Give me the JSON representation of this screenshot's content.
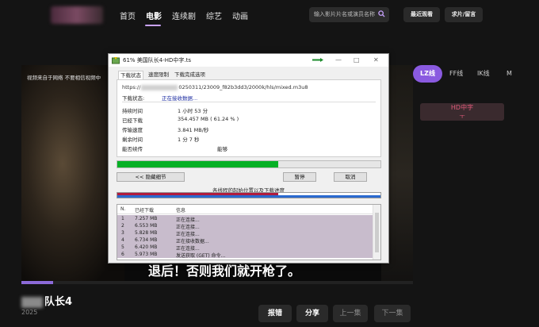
{
  "nav": {
    "items": [
      {
        "label": "首页",
        "active": false
      },
      {
        "label": "电影",
        "active": true
      },
      {
        "label": "连续剧",
        "active": false
      },
      {
        "label": "综艺",
        "active": false
      },
      {
        "label": "动画",
        "active": false
      }
    ],
    "search_placeholder": "输入影片片名或演员名称",
    "recent_label": "最近观看",
    "request_label": "求片/留言"
  },
  "player": {
    "warning": "视频来自于网络 不要相信视频中",
    "subtitle": "退后！否则我们就开枪了。",
    "progress": 0.08
  },
  "lines": {
    "tabs": [
      {
        "label": "LZ线",
        "active": true
      },
      {
        "label": "FF线",
        "active": false
      },
      {
        "label": "IK线",
        "active": false
      },
      {
        "label": "M",
        "active": false
      }
    ],
    "episode_card": {
      "line1": "HD中字",
      "line2": "ㅜ"
    }
  },
  "movie": {
    "title_suffix": "队长4",
    "year": "2025"
  },
  "actions": {
    "report": "报错",
    "share": "分享",
    "prev": "上一集",
    "next": "下一集"
  },
  "dialog": {
    "title": "61% 美国队长4-HD中字.ts",
    "tabs": [
      "下载状态",
      "速度限制",
      "下载完成选项"
    ],
    "url_prefix": "https://",
    "url_suffix": "0250311/23009_f82b3dd3/2000k/hls/mixed.m3u8",
    "status_label": "下载状态:",
    "status_value": "正在接收数据...",
    "rows": [
      {
        "label": "持续时间",
        "value": "1 小时 53 分"
      },
      {
        "label": "已经下载",
        "value": "354.457  MB  ( 61.24 % )"
      },
      {
        "label": "传输速度",
        "value": "3.841  MB/秒"
      },
      {
        "label": "剩余时间",
        "value": "1 分 7 秒"
      },
      {
        "label": "能否续传",
        "value": "能够"
      }
    ],
    "progress": 0.6124,
    "hide_details": "<< 隐藏细节",
    "pause": "暂停",
    "cancel": "取消",
    "connections_label": "各线程的起始位置以及下载进度",
    "table_headers": [
      "N.",
      "已经下载",
      "信息"
    ],
    "table_rows": [
      {
        "n": "1",
        "size": "7.257  MB",
        "info": "正在连接..."
      },
      {
        "n": "2",
        "size": "6.553  MB",
        "info": "正在连接..."
      },
      {
        "n": "3",
        "size": "5.828  MB",
        "info": "正在连接..."
      },
      {
        "n": "4",
        "size": "6.734  MB",
        "info": "正在接收数据..."
      },
      {
        "n": "5",
        "size": "6.420  MB",
        "info": "正在连接..."
      },
      {
        "n": "6",
        "size": "5.973  MB",
        "info": "发送获取 (GET) 命令..."
      }
    ]
  }
}
